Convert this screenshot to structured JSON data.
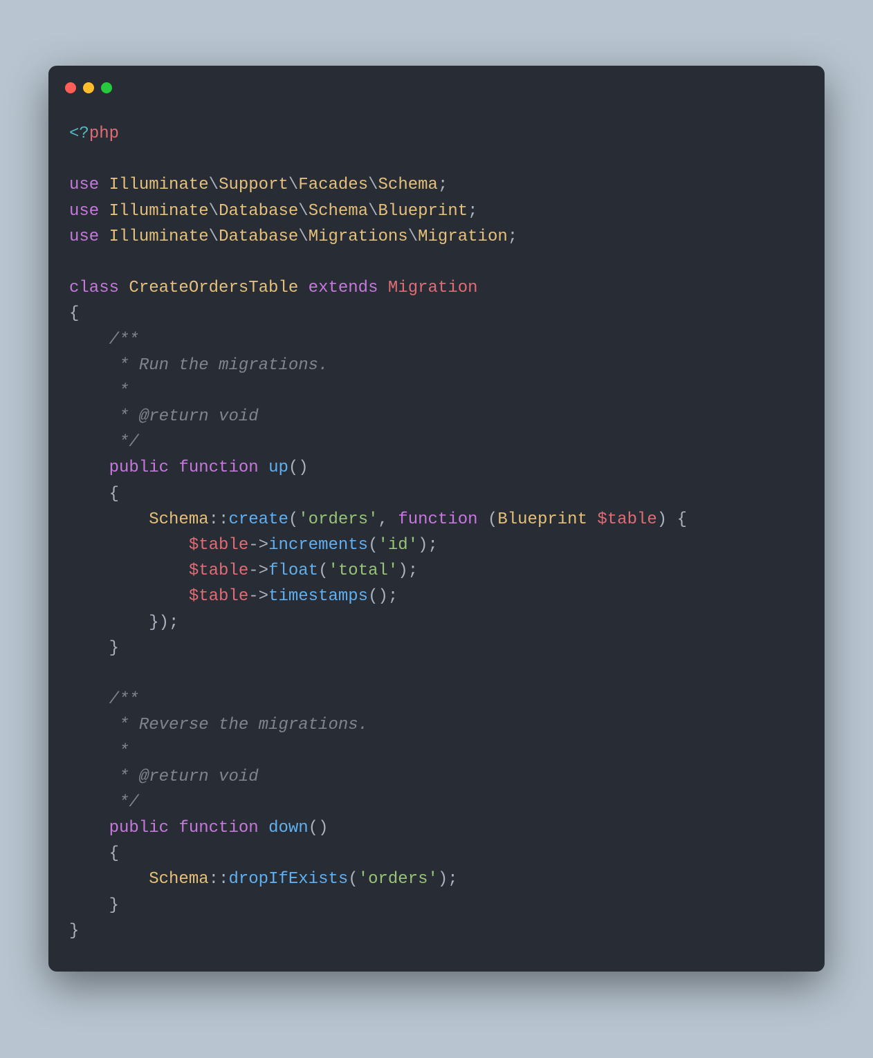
{
  "colors": {
    "pageBg": "#b8c5d0",
    "windowBg": "#282c34",
    "dotRed": "#ff5f56",
    "dotYellow": "#ffbd2e",
    "dotGreen": "#27c93f",
    "textDefault": "#abb2bf",
    "keyword": "#c678dd",
    "type": "#e5c07b",
    "func": "#61afef",
    "string": "#98c379",
    "variable": "#e06c75",
    "comment": "#7f848e",
    "operator": "#56b6c2"
  },
  "language": "php",
  "code": {
    "openTag": {
      "lt": "<?",
      "php": "php"
    },
    "use1": {
      "kw": "use",
      "ns": "Illuminate",
      "p1": "Support",
      "p2": "Facades",
      "cls": "Schema"
    },
    "use2": {
      "kw": "use",
      "ns": "Illuminate",
      "p1": "Database",
      "p2": "Schema",
      "cls": "Blueprint"
    },
    "use3": {
      "kw": "use",
      "ns": "Illuminate",
      "p1": "Database",
      "p2": "Migrations",
      "cls": "Migration"
    },
    "classLine": {
      "kw_class": "class",
      "name": "CreateOrdersTable",
      "kw_extends": "extends",
      "parent": "Migration"
    },
    "braceOpen": "{",
    "braceClose": "}",
    "comment_up": {
      "l1": "/**",
      "l2": " * Run the migrations.",
      "l3": " *",
      "l4": " * @return void",
      "l5": " */"
    },
    "fn_up": {
      "vis": "public",
      "kw": "function",
      "name": "up",
      "parens": "()"
    },
    "upBody": {
      "schema": "Schema",
      "dcol": "::",
      "create": "create",
      "arg1": "'orders'",
      "comma": ", ",
      "kw_fn": "function",
      "paramType": "Blueprint",
      "paramVar": "$table",
      "openp": " (",
      "closep": ") {",
      "row1": {
        "var": "$table",
        "arrow": "->",
        "method": "increments",
        "arg": "'id'",
        "end": ");"
      },
      "row2": {
        "var": "$table",
        "arrow": "->",
        "method": "float",
        "arg": "'total'",
        "end": ");"
      },
      "row3": {
        "var": "$table",
        "arrow": "->",
        "method": "timestamps",
        "arg": "",
        "end": "();"
      },
      "closeCb": "});"
    },
    "comment_down": {
      "l1": "/**",
      "l2": " * Reverse the migrations.",
      "l3": " *",
      "l4": " * @return void",
      "l5": " */"
    },
    "fn_down": {
      "vis": "public",
      "kw": "function",
      "name": "down",
      "parens": "()"
    },
    "downBody": {
      "schema": "Schema",
      "dcol": "::",
      "method": "dropIfExists",
      "arg": "'orders'",
      "end": ");"
    }
  }
}
